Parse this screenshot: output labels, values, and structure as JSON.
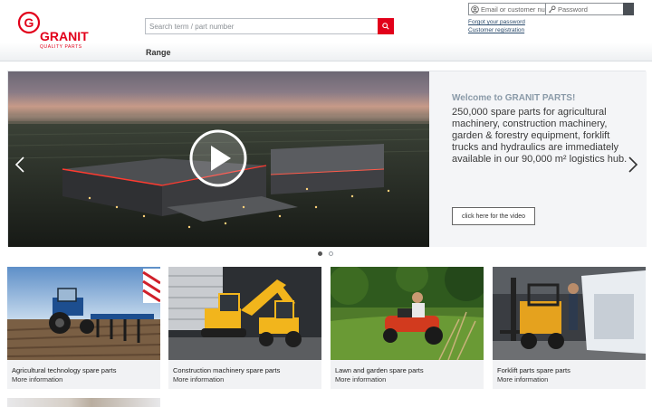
{
  "brand": {
    "name": "GRANIT",
    "tagline": "QUALITY PARTS",
    "letter": "G",
    "color": "#e2001a"
  },
  "search": {
    "placeholder": "Search term / part number"
  },
  "nav": {
    "range": "Range"
  },
  "login": {
    "user_placeholder": "Email or customer number",
    "password_placeholder": "Password",
    "forgot": "Forgot your password",
    "register": "Customer registration"
  },
  "slider": {
    "welcome": "Welcome to GRANIT PARTS!",
    "blurb": "250,000 spare parts for agricultural machinery, construction machinery, garden & forestry equipment, forklift trucks and hydraulics are immediately available in our 90,000 m² logistics hub.",
    "video_button": "click here for the video"
  },
  "categories": [
    {
      "title": "Agricultural technology spare parts",
      "more": "More information"
    },
    {
      "title": "Construction machinery spare parts",
      "more": "More information"
    },
    {
      "title": "Lawn and garden spare parts",
      "more": "More information"
    },
    {
      "title": "Forklift parts spare parts",
      "more": "More information"
    }
  ],
  "icons": {
    "search_button": "search-icon",
    "user_field": "user-icon",
    "password_field": "key-icon",
    "slider_prev": "chevron-left-icon",
    "slider_next": "chevron-right-icon",
    "video": "play-icon"
  }
}
